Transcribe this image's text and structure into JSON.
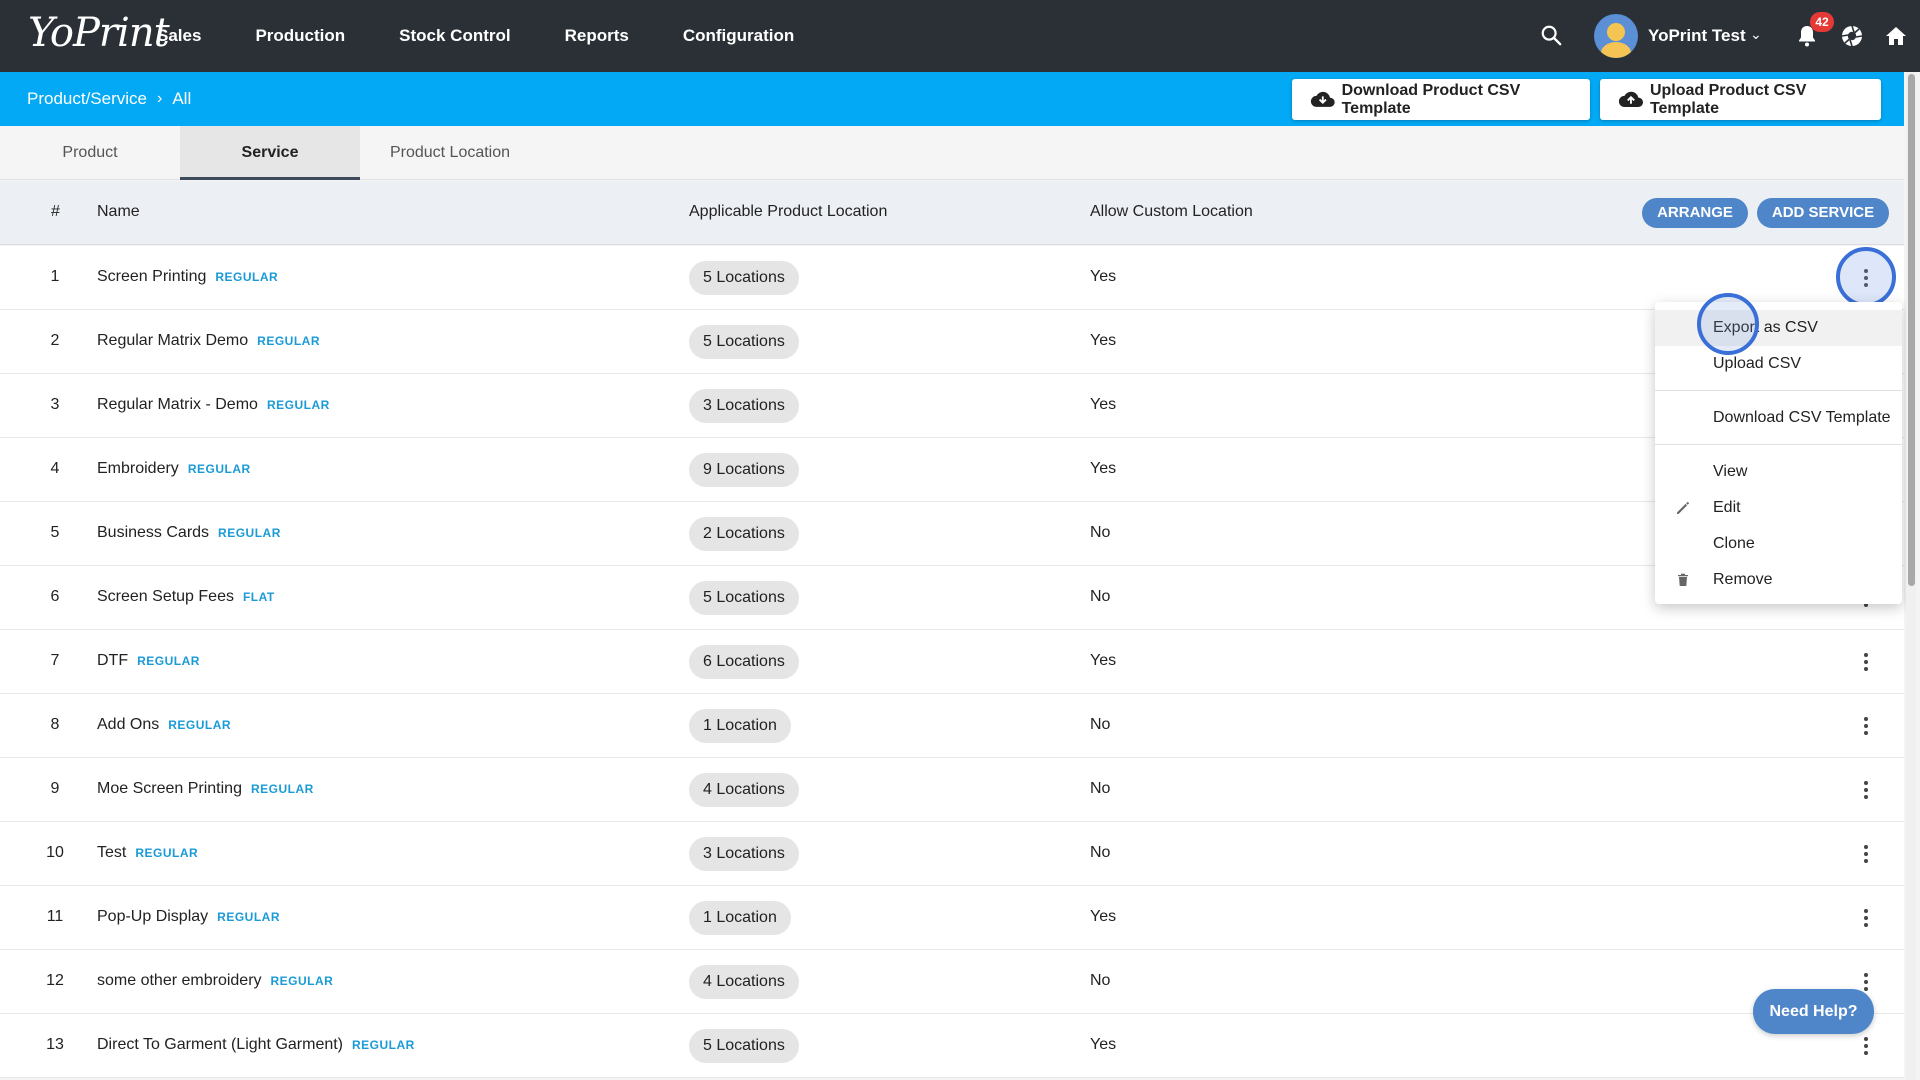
{
  "app": {
    "logo": "YoPrint"
  },
  "nav": {
    "items": [
      "Sales",
      "Production",
      "Stock Control",
      "Reports",
      "Configuration"
    ],
    "user_name": "YoPrint Test",
    "notification_count": "42"
  },
  "breadcrumb": {
    "parent": "Product/Service",
    "current": "All"
  },
  "header_buttons": {
    "download": "Download Product CSV Template",
    "upload": "Upload Product CSV Template"
  },
  "tabs": [
    {
      "label": "Product",
      "active": false
    },
    {
      "label": "Service",
      "active": true
    },
    {
      "label": "Product Location",
      "active": false
    }
  ],
  "table": {
    "headers": {
      "num": "#",
      "name": "Name",
      "location": "Applicable Product Location",
      "custom": "Allow Custom Location"
    },
    "actions": {
      "arrange": "ARRANGE",
      "add": "ADD SERVICE"
    },
    "rows": [
      {
        "num": "1",
        "name": "Screen Printing",
        "type": "REGULAR",
        "locations": "5 Locations",
        "allow": "Yes"
      },
      {
        "num": "2",
        "name": "Regular Matrix Demo",
        "type": "REGULAR",
        "locations": "5 Locations",
        "allow": "Yes"
      },
      {
        "num": "3",
        "name": "Regular Matrix - Demo",
        "type": "REGULAR",
        "locations": "3 Locations",
        "allow": "Yes"
      },
      {
        "num": "4",
        "name": "Embroidery",
        "type": "REGULAR",
        "locations": "9 Locations",
        "allow": "Yes"
      },
      {
        "num": "5",
        "name": "Business Cards",
        "type": "REGULAR",
        "locations": "2 Locations",
        "allow": "No"
      },
      {
        "num": "6",
        "name": "Screen Setup Fees",
        "type": "FLAT",
        "locations": "5 Locations",
        "allow": "No"
      },
      {
        "num": "7",
        "name": "DTF",
        "type": "REGULAR",
        "locations": "6 Locations",
        "allow": "Yes"
      },
      {
        "num": "8",
        "name": "Add Ons",
        "type": "REGULAR",
        "locations": "1 Location",
        "allow": "No"
      },
      {
        "num": "9",
        "name": "Moe Screen Printing",
        "type": "REGULAR",
        "locations": "4 Locations",
        "allow": "No"
      },
      {
        "num": "10",
        "name": "Test",
        "type": "REGULAR",
        "locations": "3 Locations",
        "allow": "No"
      },
      {
        "num": "11",
        "name": "Pop-Up Display",
        "type": "REGULAR",
        "locations": "1 Location",
        "allow": "Yes"
      },
      {
        "num": "12",
        "name": "some other embroidery",
        "type": "REGULAR",
        "locations": "4 Locations",
        "allow": "No"
      },
      {
        "num": "13",
        "name": "Direct To Garment (Light Garment)",
        "type": "REGULAR",
        "locations": "5 Locations",
        "allow": "Yes"
      }
    ]
  },
  "menu": {
    "export": "Export as CSV",
    "upload": "Upload CSV",
    "download_template": "Download CSV Template",
    "view": "View",
    "edit": "Edit",
    "clone": "Clone",
    "remove": "Remove"
  },
  "help": {
    "label": "Need Help?"
  },
  "colors": {
    "topbar": "#2b3036",
    "subbar": "#03a9f4",
    "accent": "#4f86c9",
    "type_tag": "#1a9bd7"
  }
}
